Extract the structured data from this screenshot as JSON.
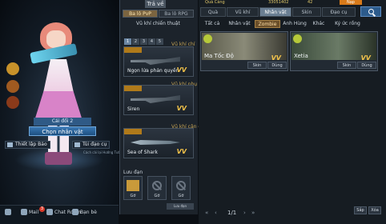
{
  "character": {
    "rank_label": "Cái đổi 2",
    "choose_label": "Chọn nhân vật",
    "left_button": "Thiết lập Bảo",
    "right_button": "Túi đạo cụ",
    "hint": "Cách cài lại Hướng Tướng"
  },
  "bottom_bar": {
    "mail": "Mail",
    "mail_count": "3",
    "chat": "Chat Room",
    "friends": "Bạn bè"
  },
  "weapon_panel": {
    "title": "Trả về",
    "tabs": [
      "Ba lô PvP",
      "Ba lô RPG"
    ],
    "section_title": "Vũ khí chiến thuật",
    "slot_numbers": [
      "1",
      "2",
      "3",
      "4",
      "5"
    ],
    "categories": {
      "primary": "Vũ khí chí",
      "secondary": "Vũ khí phụ",
      "melee": "Vũ khí cận chiến"
    },
    "weapons": [
      {
        "name": "Ngọn lửa phản quyền",
        "grade": "VV"
      },
      {
        "name": "Siren",
        "grade": "VV"
      },
      {
        "name": "Sea of Shark",
        "grade": "VV"
      }
    ],
    "lifesave_label": "Lưu đạn",
    "lifesave_slot_label": "Gỡ",
    "bottom_button": "Lưu đạn"
  },
  "shop": {
    "currency_1": "Quà Cáng",
    "currency_2": "33051402",
    "currency_3": "42",
    "topup": "Nạp",
    "main_tabs": [
      "Quà",
      "Vũ khí",
      "Nhân vật",
      "Skin",
      "Đạo cụ"
    ],
    "active_main_tab": "Nhân vật",
    "sub_tabs": [
      "Tất cả",
      "Nhân vật",
      "Zombie",
      "Anh Hùng",
      "Khác",
      "Ký ức rồng"
    ],
    "active_sub_tab": "Zombie",
    "items": [
      {
        "name": "Ma Tốc Độ",
        "grade": "VV",
        "btn1": "Skin",
        "btn2": "Dùng"
      },
      {
        "name": "Xetia",
        "grade": "VV",
        "btn1": "Skin",
        "btn2": "Dùng"
      }
    ],
    "page": "1/1",
    "buttons": {
      "arrange": "Sắp",
      "delete": "Xóa"
    }
  }
}
